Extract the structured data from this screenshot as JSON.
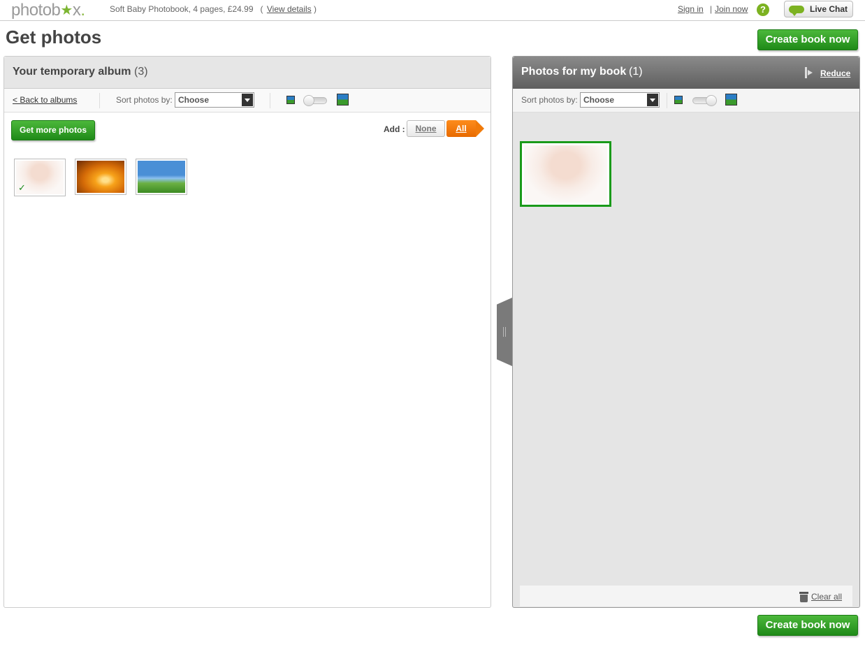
{
  "header": {
    "logo": "photobox",
    "logo_parts": [
      "photob",
      "x",
      "."
    ],
    "product": "Soft Baby Photobook,  4 pages,  £24.99",
    "view_open": "(",
    "view_details": "View details",
    "view_close": ")",
    "sign_in": "Sign in",
    "sep": "|",
    "join_now": "Join now",
    "help": "?",
    "live_chat": "Live Chat"
  },
  "page_title": "Get photos",
  "create_book": "Create book now",
  "album": {
    "title": "Your temporary album",
    "count": "(3)",
    "back_link": "< Back to albums",
    "sort_label": "Sort photos by:",
    "sort_value": "Choose",
    "get_more": "Get more photos",
    "add_label": "Add :",
    "add_none": "None",
    "add_all": "All",
    "check_mark": "✓"
  },
  "book": {
    "title": "Photos for my book",
    "count": "(1)",
    "reduce": "Reduce",
    "sort_label": "Sort photos by:",
    "sort_value": "Choose",
    "clear_all": "Clear all"
  },
  "colors": {
    "green_button": "#2a9a22",
    "orange_all": "#f07a0a",
    "selected_border": "#1a9a1a",
    "right_header": "#707070"
  }
}
